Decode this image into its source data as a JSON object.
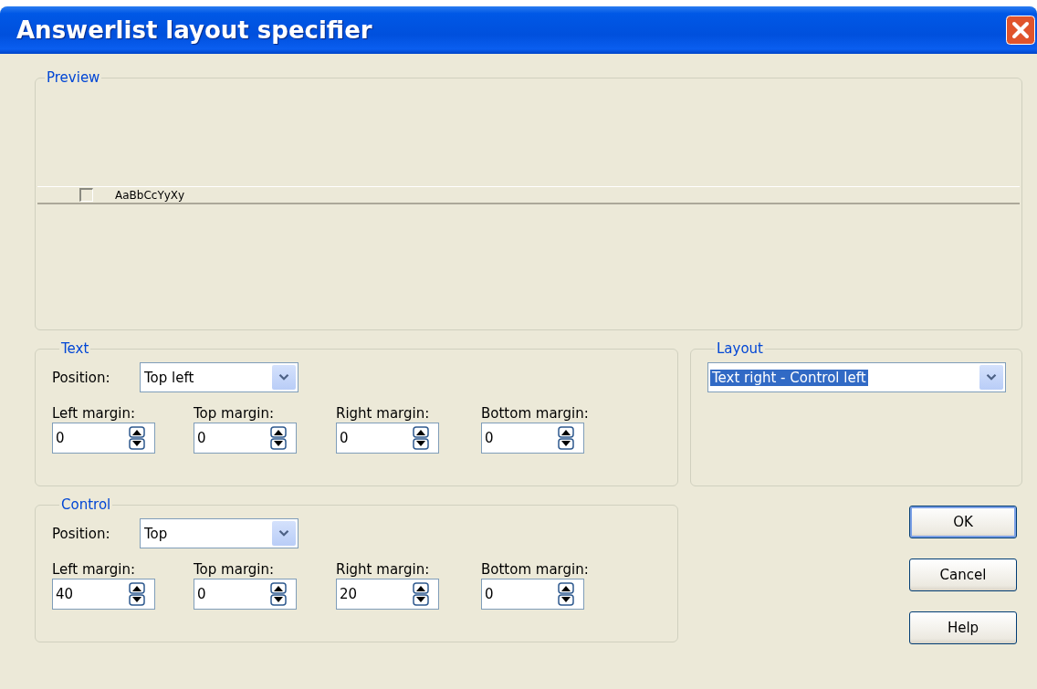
{
  "window": {
    "title": "Answerlist layout specifier"
  },
  "preview": {
    "legend": "Preview",
    "sample": {
      "checked": false,
      "label": "AaBbCcYyXy"
    }
  },
  "text_group": {
    "legend": "Text",
    "position": {
      "label": "Position:",
      "value": "Top left"
    },
    "margins": [
      {
        "label": "Left margin:",
        "value": "0"
      },
      {
        "label": "Top margin:",
        "value": "0"
      },
      {
        "label": "Right margin:",
        "value": "0"
      },
      {
        "label": "Bottom margin:",
        "value": "0"
      }
    ]
  },
  "layout_group": {
    "legend": "Layout",
    "value": "Text right - Control left",
    "highlighted": true
  },
  "control_group": {
    "legend": "Control",
    "position": {
      "label": "Position:",
      "value": "Top"
    },
    "margins": [
      {
        "label": "Left margin:",
        "value": "40"
      },
      {
        "label": "Top margin:",
        "value": "0"
      },
      {
        "label": "Right margin:",
        "value": "20"
      },
      {
        "label": "Bottom margin:",
        "value": "0"
      }
    ]
  },
  "buttons": [
    {
      "label": "OK",
      "default": true
    },
    {
      "label": "Cancel",
      "default": false
    },
    {
      "label": "Help",
      "default": false
    }
  ]
}
